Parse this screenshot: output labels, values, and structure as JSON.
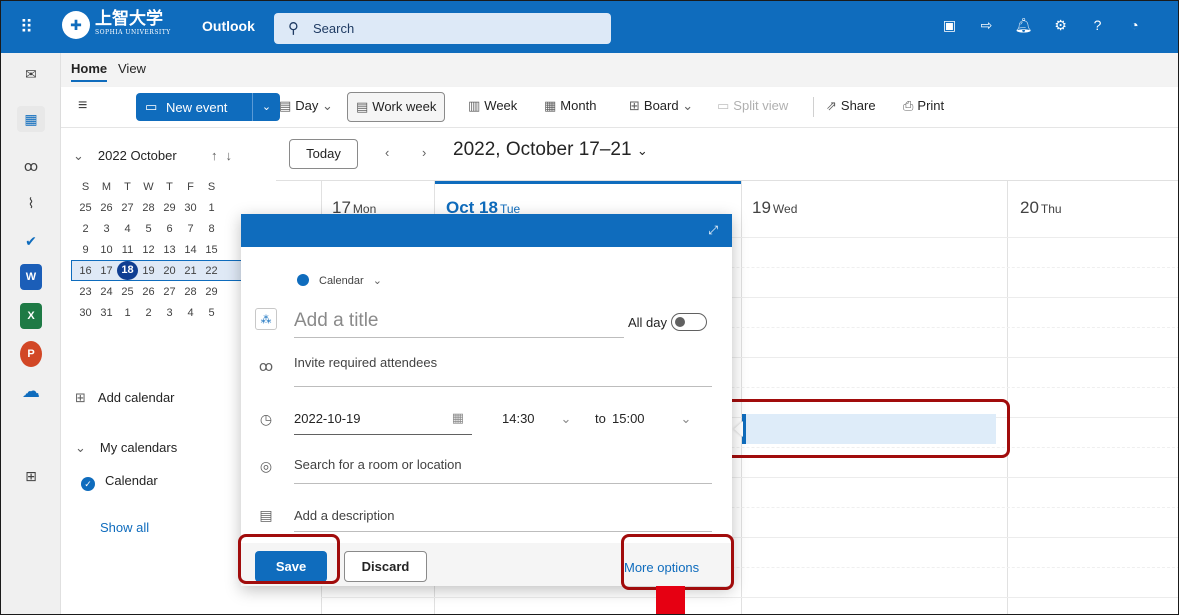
{
  "topbar": {
    "univ_name_jp": "上智大学",
    "univ_name_en": "SOPHIA UNIVERSITY",
    "app_name": "Outlook",
    "search_placeholder": "Search"
  },
  "ribbon": {
    "tabs": [
      "Home",
      "View"
    ],
    "new_event": "New event",
    "views": {
      "day": "Day",
      "work_week": "Work week",
      "week": "Week",
      "month": "Month",
      "board": "Board",
      "split_view": "Split view"
    },
    "share": "Share",
    "print": "Print"
  },
  "mini_calendar": {
    "header": "2022 October",
    "weekdays": [
      "S",
      "M",
      "T",
      "W",
      "T",
      "F",
      "S"
    ],
    "weeks": [
      [
        "25",
        "26",
        "27",
        "28",
        "29",
        "30",
        "1"
      ],
      [
        "2",
        "3",
        "4",
        "5",
        "6",
        "7",
        "8"
      ],
      [
        "9",
        "10",
        "11",
        "12",
        "13",
        "14",
        "15"
      ],
      [
        "16",
        "17",
        "18",
        "19",
        "20",
        "21",
        "22"
      ],
      [
        "23",
        "24",
        "25",
        "26",
        "27",
        "28",
        "29"
      ],
      [
        "30",
        "31",
        "1",
        "2",
        "3",
        "4",
        "5"
      ]
    ],
    "today": "18",
    "add_calendar": "Add calendar",
    "my_calendars": "My calendars",
    "calendar_item": "Calendar",
    "show_all": "Show all"
  },
  "calendar": {
    "today_button": "Today",
    "range_label": "2022, October 17–21",
    "days": [
      {
        "num": "17",
        "name": "Mon"
      },
      {
        "num": "Oct 18",
        "name": "Tue"
      },
      {
        "num": "19",
        "name": "Wed"
      },
      {
        "num": "20",
        "name": "Thu"
      }
    ]
  },
  "popup": {
    "calendar_select": "Calendar",
    "title_placeholder": "Add a title",
    "all_day_label": "All day",
    "attendees_placeholder": "Invite required attendees",
    "date": "2022-10-19",
    "start_time": "14:30",
    "to_label": "to",
    "end_time": "15:00",
    "location_placeholder": "Search for a room or location",
    "description_placeholder": "Add a description",
    "save": "Save",
    "discard": "Discard",
    "more_options": "More options"
  },
  "colors": {
    "brand": "#0f6cbd",
    "highlight": "#a10c0c",
    "arrow": "#e60012"
  }
}
